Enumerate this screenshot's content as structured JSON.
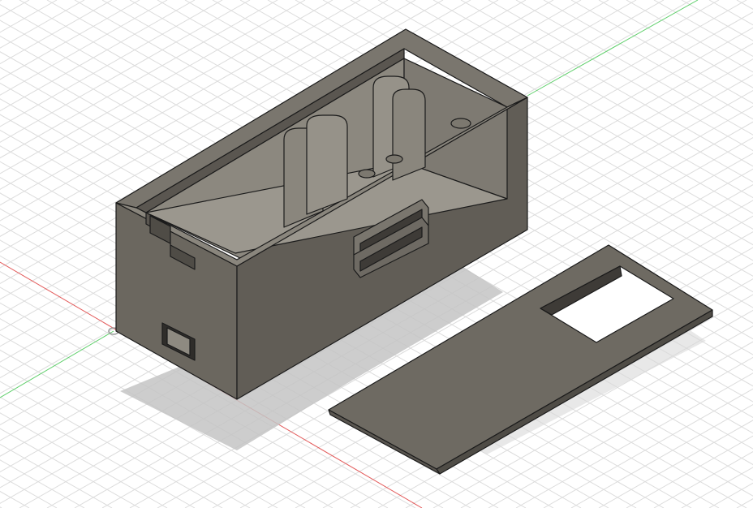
{
  "viewport": {
    "background": "#ffffff",
    "grid_color": "#dcdcdc",
    "axis_x_color": "#e35b5b",
    "axis_y_color": "#5fcf6b"
  },
  "model": {
    "body_color": "#6b675f",
    "body_dark": "#4a4742",
    "body_light": "#8e8a81",
    "edge_color": "#1b1b1b",
    "shadow_color": "#bfbfbf",
    "icons": [
      "origin-icon"
    ]
  }
}
